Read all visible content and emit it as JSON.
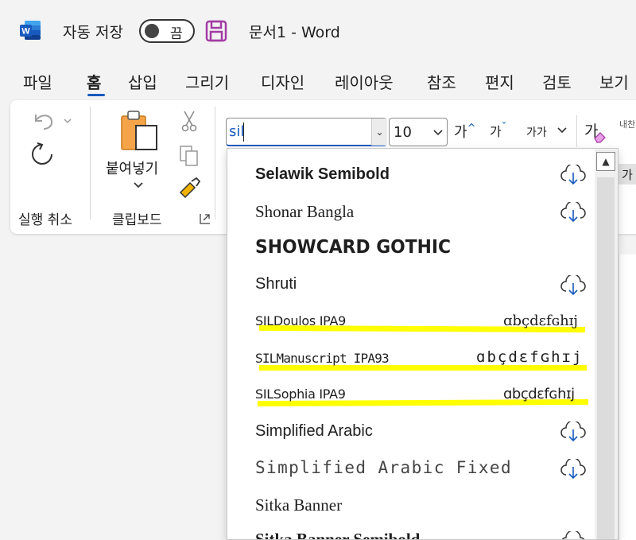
{
  "titlebar": {
    "app_icon": "word-logo-icon",
    "autosave_label": "자동 저장",
    "toggle_state": "끔",
    "save_icon": "save-icon",
    "document_title": "문서1  -  Word"
  },
  "tabs": [
    {
      "label": "파일"
    },
    {
      "label": "홈"
    },
    {
      "label": "삽입"
    },
    {
      "label": "그리기"
    },
    {
      "label": "디자인"
    },
    {
      "label": "레이아웃"
    },
    {
      "label": "참조"
    },
    {
      "label": "편지"
    },
    {
      "label": "검토"
    },
    {
      "label": "보기"
    }
  ],
  "ribbon": {
    "undo_group_label": "실행 취소",
    "clipboard_group_label": "클립보드",
    "paste_label": "붙여넣기",
    "font_box_value": "sil",
    "font_size_value": "10",
    "grow_label": "가",
    "shrink_label": "가",
    "case_label": "가가",
    "clear_format_label": "가",
    "styles_peek": "가",
    "right_cut_label": "내찬"
  },
  "font_dropdown": {
    "items": [
      {
        "name": "Selawik Semibold",
        "cloud": true,
        "highlight": false
      },
      {
        "name": "Shonar Bangla",
        "cloud": true,
        "highlight": false
      },
      {
        "name": "SHOWCARD GOTHIC",
        "cloud": false,
        "highlight": false
      },
      {
        "name": "Shruti",
        "cloud": true,
        "highlight": false
      },
      {
        "name": "SILDoulos IPA9",
        "sample": "ɑbçdɛfɢhɪj",
        "highlight": true
      },
      {
        "name": "SILManuscript IPA93",
        "sample": "ɑbçdɛfɢhɪj",
        "highlight": true
      },
      {
        "name": "SILSophia IPA9",
        "sample": "ɑbçdɛfɢhɪj",
        "highlight": true
      },
      {
        "name": "Simplified Arabic",
        "cloud": true,
        "highlight": false
      },
      {
        "name": "Simplified Arabic Fixed",
        "cloud": true,
        "highlight": false
      },
      {
        "name": "Sitka Banner",
        "cloud": false,
        "highlight": false
      },
      {
        "name": "Sitka Banner Semibold",
        "cloud": true,
        "highlight": false
      }
    ]
  },
  "colors": {
    "accent": "#185abd",
    "highlight": "#ffff00",
    "word_blue": "#2b579a",
    "save_purple": "#8b3a9e"
  }
}
